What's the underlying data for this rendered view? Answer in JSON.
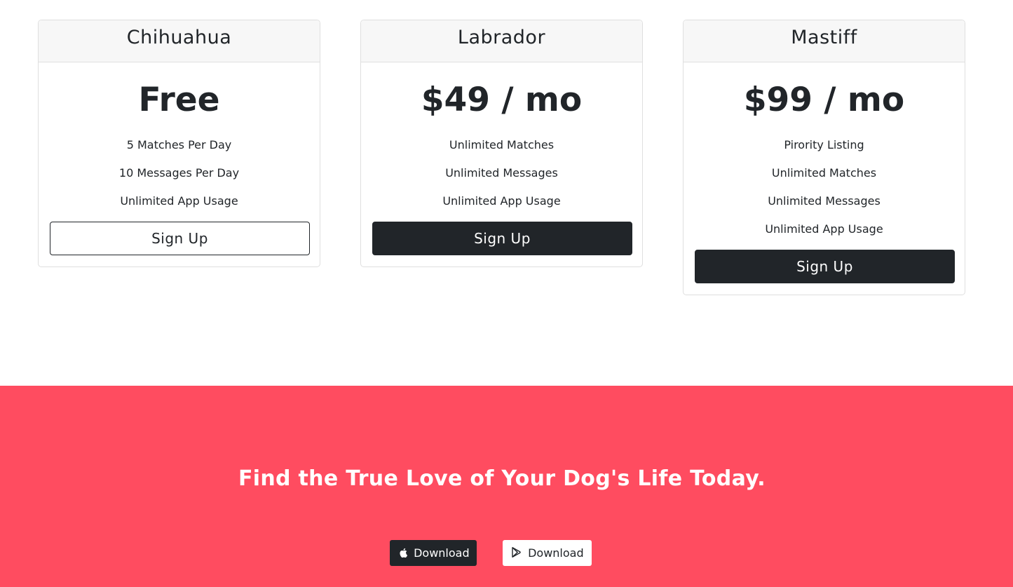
{
  "plans": [
    {
      "name": "Chihuahua",
      "price": "Free",
      "features": [
        "5 Matches Per Day",
        "10 Messages Per Day",
        "Unlimited App Usage"
      ],
      "button_label": "Sign Up",
      "button_style": "outline"
    },
    {
      "name": "Labrador",
      "price": "$49 / mo",
      "features": [
        "Unlimited Matches",
        "Unlimited Messages",
        "Unlimited App Usage"
      ],
      "button_label": "Sign Up",
      "button_style": "dark"
    },
    {
      "name": "Mastiff",
      "price": "$99 / mo",
      "features": [
        "Pirority Listing",
        "Unlimited Matches",
        "Unlimited Messages",
        "Unlimited App Usage"
      ],
      "button_label": "Sign Up",
      "button_style": "dark"
    }
  ],
  "cta": {
    "title": "Find the True Love of Your Dog's Life Today.",
    "background_color": "#ff4c60",
    "download_apple": {
      "label": "Download",
      "icon": "apple-icon"
    },
    "download_play": {
      "label": "Download",
      "icon": "google-play-icon"
    }
  }
}
